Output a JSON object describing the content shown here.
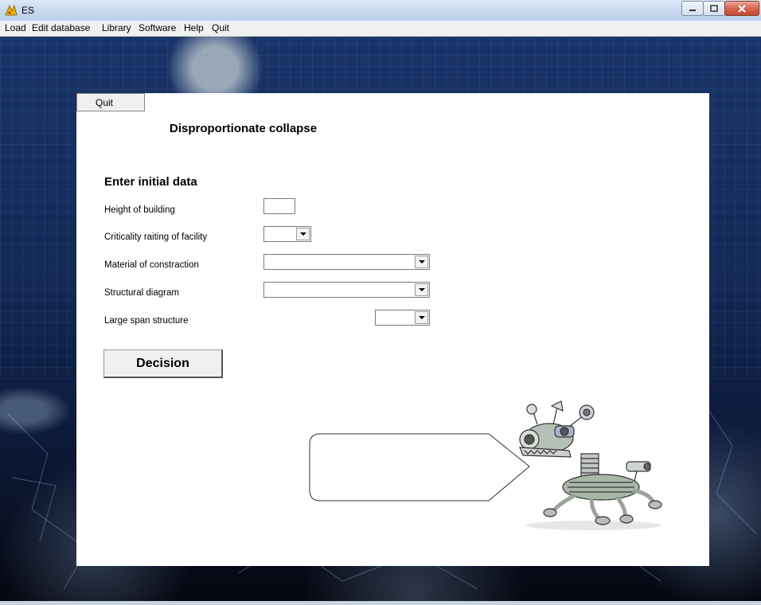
{
  "window": {
    "title": "ES",
    "app_icon": "es-app-icon"
  },
  "menu": [
    "Load",
    "Edit database",
    "Library",
    "Software",
    "Help",
    "Quit"
  ],
  "panel": {
    "quit_label": "Quit",
    "heading": "Disproportionate collapse",
    "sub_heading": "Enter initial data",
    "fields": [
      {
        "label": "Height of building",
        "type": "textbox",
        "value": ""
      },
      {
        "label": "Criticality raiting of facility",
        "type": "combo",
        "value": ""
      },
      {
        "label": "Material of constraction",
        "type": "combo",
        "value": ""
      },
      {
        "label": "Structural diagram",
        "type": "combo",
        "value": ""
      },
      {
        "label": "Large span structure",
        "type": "combo",
        "value": ""
      }
    ],
    "decision_label": "Decision",
    "speech_bubble_text": ""
  },
  "colors": {
    "panel": "#ffffff",
    "background": "#142a58",
    "titlebar": "#c7d8ee"
  }
}
